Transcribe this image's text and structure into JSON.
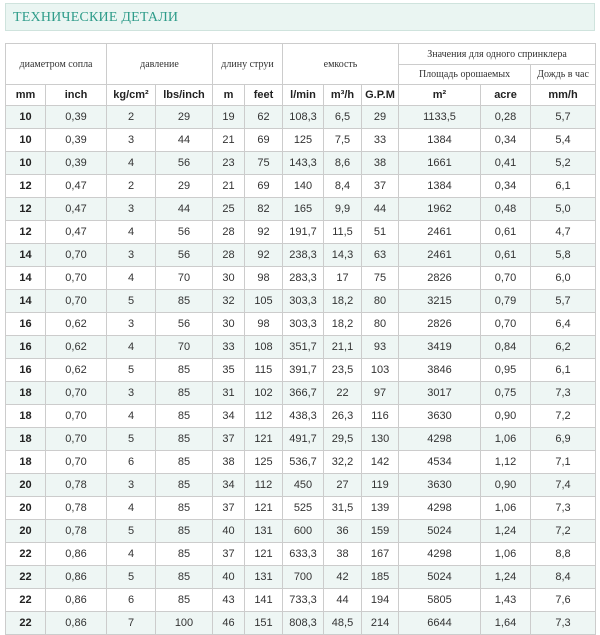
{
  "title": "ТЕХНИЧЕСКИЕ ДЕТАЛИ",
  "header": {
    "nozzle": "диаметром сопла",
    "pressure": "давление",
    "jet": "длину струи",
    "capacity": "емкость",
    "per_sprinkler": "Значения для одного спринклера",
    "area": "Площадь орошаемых",
    "rain": "Дождь в час"
  },
  "units": [
    "mm",
    "inch",
    "kg/cm²",
    "lbs/inch",
    "m",
    "feet",
    "l/min",
    "m³/h",
    "G.P.M",
    "m²",
    "acre",
    "mm/h"
  ],
  "rows": [
    [
      "10",
      "0,39",
      "2",
      "29",
      "19",
      "62",
      "108,3",
      "6,5",
      "29",
      "1133,5",
      "0,28",
      "5,7"
    ],
    [
      "10",
      "0,39",
      "3",
      "44",
      "21",
      "69",
      "125",
      "7,5",
      "33",
      "1384",
      "0,34",
      "5,4"
    ],
    [
      "10",
      "0,39",
      "4",
      "56",
      "23",
      "75",
      "143,3",
      "8,6",
      "38",
      "1661",
      "0,41",
      "5,2"
    ],
    [
      "12",
      "0,47",
      "2",
      "29",
      "21",
      "69",
      "140",
      "8,4",
      "37",
      "1384",
      "0,34",
      "6,1"
    ],
    [
      "12",
      "0,47",
      "3",
      "44",
      "25",
      "82",
      "165",
      "9,9",
      "44",
      "1962",
      "0,48",
      "5,0"
    ],
    [
      "12",
      "0,47",
      "4",
      "56",
      "28",
      "92",
      "191,7",
      "11,5",
      "51",
      "2461",
      "0,61",
      "4,7"
    ],
    [
      "14",
      "0,70",
      "3",
      "56",
      "28",
      "92",
      "238,3",
      "14,3",
      "63",
      "2461",
      "0,61",
      "5,8"
    ],
    [
      "14",
      "0,70",
      "4",
      "70",
      "30",
      "98",
      "283,3",
      "17",
      "75",
      "2826",
      "0,70",
      "6,0"
    ],
    [
      "14",
      "0,70",
      "5",
      "85",
      "32",
      "105",
      "303,3",
      "18,2",
      "80",
      "3215",
      "0,79",
      "5,7"
    ],
    [
      "16",
      "0,62",
      "3",
      "56",
      "30",
      "98",
      "303,3",
      "18,2",
      "80",
      "2826",
      "0,70",
      "6,4"
    ],
    [
      "16",
      "0,62",
      "4",
      "70",
      "33",
      "108",
      "351,7",
      "21,1",
      "93",
      "3419",
      "0,84",
      "6,2"
    ],
    [
      "16",
      "0,62",
      "5",
      "85",
      "35",
      "115",
      "391,7",
      "23,5",
      "103",
      "3846",
      "0,95",
      "6,1"
    ],
    [
      "18",
      "0,70",
      "3",
      "85",
      "31",
      "102",
      "366,7",
      "22",
      "97",
      "3017",
      "0,75",
      "7,3"
    ],
    [
      "18",
      "0,70",
      "4",
      "85",
      "34",
      "112",
      "438,3",
      "26,3",
      "116",
      "3630",
      "0,90",
      "7,2"
    ],
    [
      "18",
      "0,70",
      "5",
      "85",
      "37",
      "121",
      "491,7",
      "29,5",
      "130",
      "4298",
      "1,06",
      "6,9"
    ],
    [
      "18",
      "0,70",
      "6",
      "85",
      "38",
      "125",
      "536,7",
      "32,2",
      "142",
      "4534",
      "1,12",
      "7,1"
    ],
    [
      "20",
      "0,78",
      "3",
      "85",
      "34",
      "112",
      "450",
      "27",
      "119",
      "3630",
      "0,90",
      "7,4"
    ],
    [
      "20",
      "0,78",
      "4",
      "85",
      "37",
      "121",
      "525",
      "31,5",
      "139",
      "4298",
      "1,06",
      "7,3"
    ],
    [
      "20",
      "0,78",
      "5",
      "85",
      "40",
      "131",
      "600",
      "36",
      "159",
      "5024",
      "1,24",
      "7,2"
    ],
    [
      "22",
      "0,86",
      "4",
      "85",
      "37",
      "121",
      "633,3",
      "38",
      "167",
      "4298",
      "1,06",
      "8,8"
    ],
    [
      "22",
      "0,86",
      "5",
      "85",
      "40",
      "131",
      "700",
      "42",
      "185",
      "5024",
      "1,24",
      "8,4"
    ],
    [
      "22",
      "0,86",
      "6",
      "85",
      "43",
      "141",
      "733,3",
      "44",
      "194",
      "5805",
      "1,43",
      "7,6"
    ],
    [
      "22",
      "0,86",
      "7",
      "100",
      "46",
      "151",
      "808,3",
      "48,5",
      "214",
      "6644",
      "1,64",
      "7,3"
    ]
  ]
}
